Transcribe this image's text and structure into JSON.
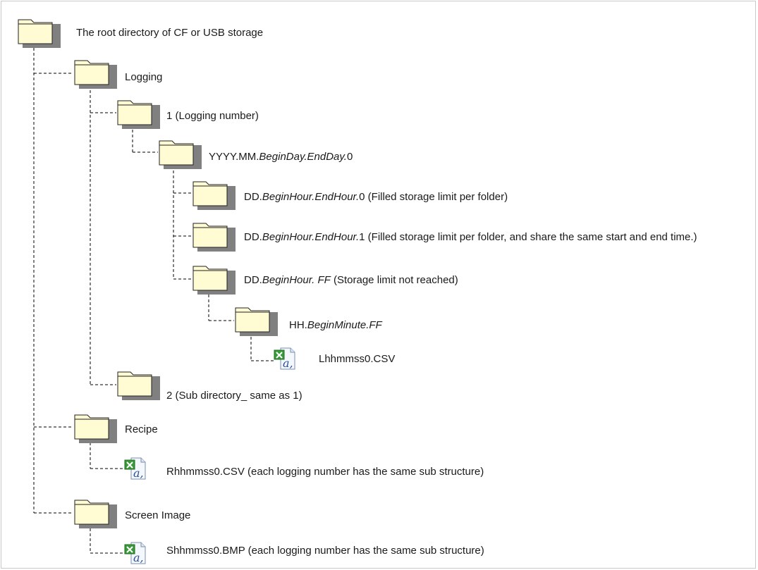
{
  "title": "",
  "icons": {
    "folder": "folder-icon",
    "csv": "excel-csv-file-icon"
  },
  "nodes": {
    "root": {
      "name": "The root directory of CF or USB storage"
    },
    "logging": {
      "name": "Logging"
    },
    "n1": {
      "name": "1 (Logging number)"
    },
    "month": {
      "prefix": "YYYY.MM.",
      "italic": "BeginDay.EndDay.",
      "suffix": "0"
    },
    "d0": {
      "prefix": "DD.",
      "italic": "BeginHour.EndHour.",
      "suffix": "0 (Filled storage limit per folder)"
    },
    "d1": {
      "prefix": "DD.",
      "italic": "BeginHour.EndHour.",
      "suffix": "1 (Filled storage limit per folder, and share the same start and end time.)"
    },
    "dff": {
      "prefix": "DD.",
      "italic": "BeginHour. FF",
      "suffix": " (Storage limit not reached)"
    },
    "hh": {
      "prefix": "HH.",
      "italic": "BeginMinute.FF",
      "suffix": ""
    },
    "lcsv": {
      "name": "Lhhmmss0.CSV"
    },
    "n2": {
      "name": "2  (Sub directory_ same as 1)"
    },
    "recipe": {
      "name": "Recipe"
    },
    "rcsv": {
      "name": "Rhhmmss0.CSV (each logging number has the same sub structure)"
    },
    "screen": {
      "name": "Screen Image"
    },
    "sbmp": {
      "name": "Shhmmss0.BMP (each logging number has the same sub structure)"
    }
  }
}
